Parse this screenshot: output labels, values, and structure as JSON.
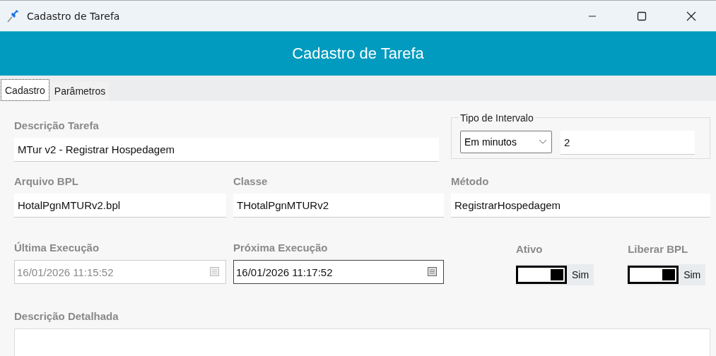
{
  "window": {
    "title": "Cadastro de Tarefa"
  },
  "header": {
    "title": "Cadastro de Tarefa"
  },
  "tabs": [
    {
      "label": "Cadastro",
      "selected": true
    },
    {
      "label": "Parâmetros",
      "selected": false
    }
  ],
  "form": {
    "descricao": {
      "label": "Descrição Tarefa",
      "value": "MTur v2 - Registrar Hospedagem"
    },
    "intervalo": {
      "legend": "Tipo de Intervalo",
      "tipo": "Em minutos",
      "valor": "2"
    },
    "arquivo": {
      "label": "Arquivo BPL",
      "value": "HotalPgnMTURv2.bpl"
    },
    "classe": {
      "label": "Classe",
      "value": "THotalPgnMTURv2"
    },
    "metodo": {
      "label": "Método",
      "value": "RegistrarHospedagem"
    },
    "dates": [
      {
        "label": "Última Execução",
        "value": "16/01/2026 11:15:52",
        "disabled": true
      },
      {
        "label": "Próxima Execução",
        "value": "16/01/2026 11:17:52",
        "disabled": false
      }
    ],
    "toggles": [
      {
        "label": "Ativo",
        "on": true,
        "text": "Sim"
      },
      {
        "label": "Liberar BPL",
        "on": true,
        "text": "Sim"
      }
    ],
    "detalhada": {
      "label": "Descrição Detalhada"
    }
  }
}
